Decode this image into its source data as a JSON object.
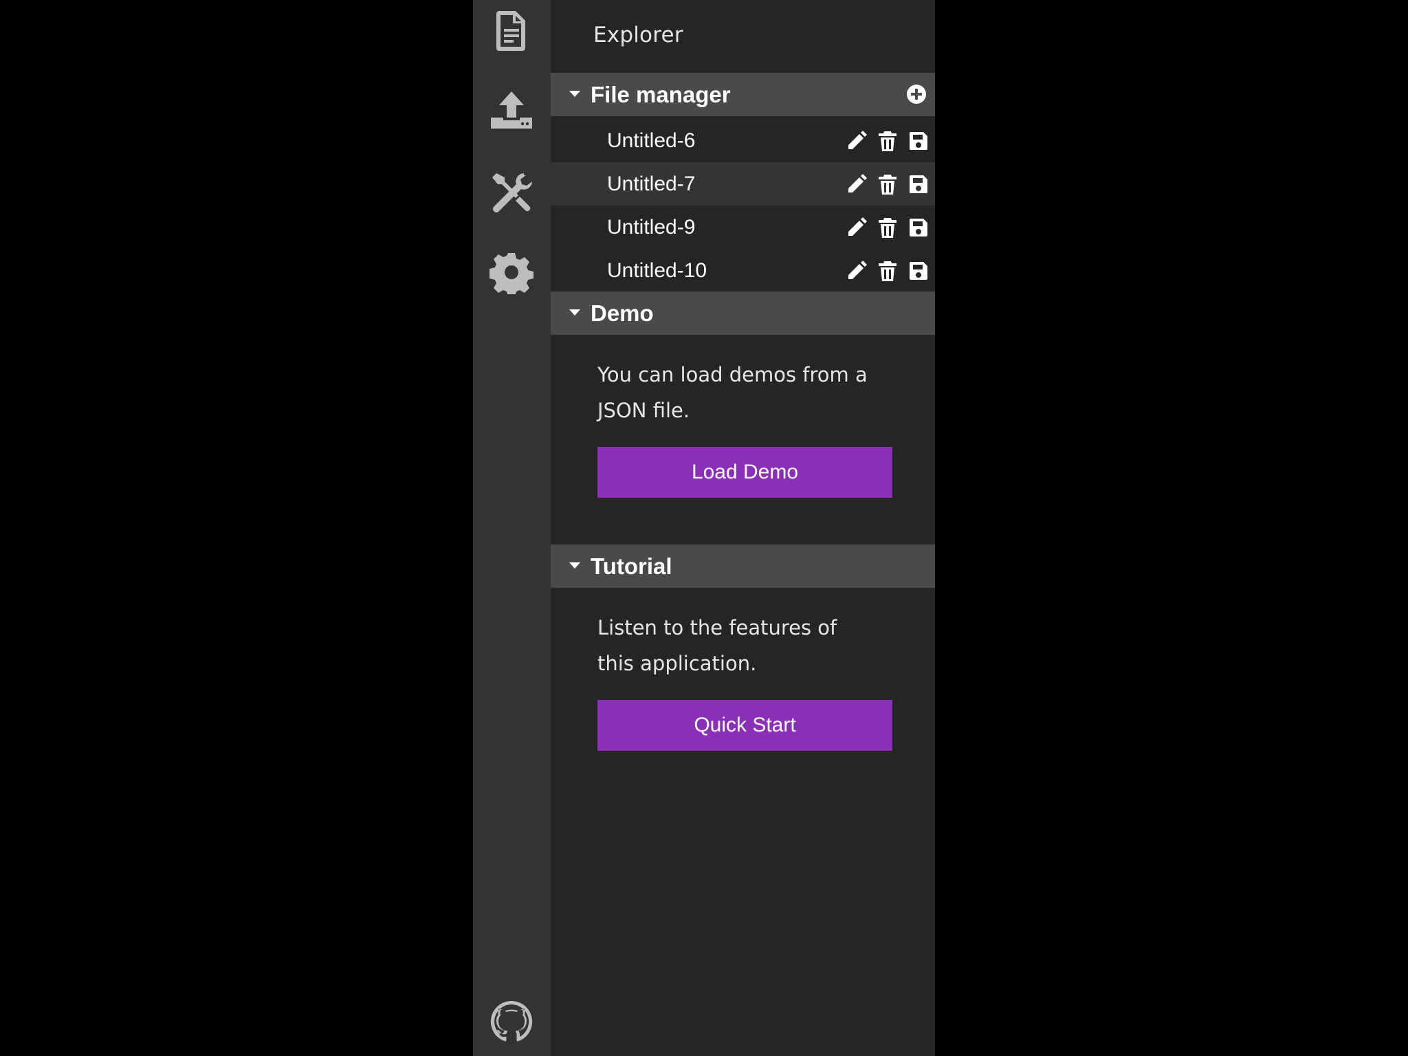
{
  "activity_bar": {
    "items": [
      {
        "name": "file-icon"
      },
      {
        "name": "upload-icon"
      },
      {
        "name": "tools-icon"
      },
      {
        "name": "gear-icon"
      }
    ],
    "footer_icon": "github-icon"
  },
  "sidebar": {
    "title": "Explorer",
    "file_manager": {
      "title": "File manager",
      "add_icon": "plus-circle-icon",
      "files": [
        {
          "name": "Untitled-6",
          "active": false
        },
        {
          "name": "Untitled-7",
          "active": true
        },
        {
          "name": "Untitled-9",
          "active": false
        },
        {
          "name": "Untitled-10",
          "active": false
        }
      ],
      "row_actions": [
        "pencil-icon",
        "trash-icon",
        "save-icon"
      ]
    },
    "demo": {
      "title": "Demo",
      "text": "You can load demos from a JSON file.",
      "button": "Load Demo"
    },
    "tutorial": {
      "title": "Tutorial",
      "text": "Listen to the features of this application.",
      "button": "Quick Start"
    }
  },
  "colors": {
    "background": "#000000",
    "activity_bar": "#333333",
    "sidebar": "#252526",
    "section_header": "#4a4a4a",
    "active_row": "#343434",
    "accent_button": "#8b2fb7"
  }
}
